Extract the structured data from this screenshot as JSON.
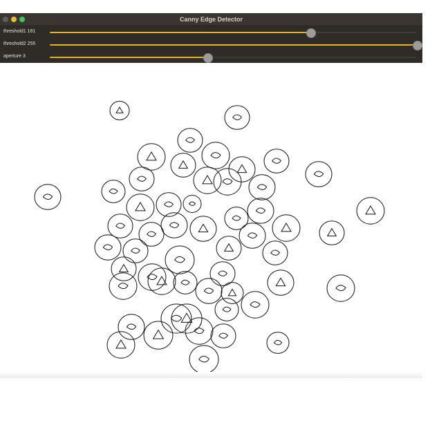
{
  "window": {
    "title": "Canny Edge Detector"
  },
  "controls": [
    {
      "label": "threshold1 181",
      "value": 181,
      "max": 255
    },
    {
      "label": "threshold2 255",
      "value": 255,
      "max": 255
    },
    {
      "label": "aperture 3",
      "value": 3,
      "max": 7
    }
  ],
  "image": {
    "description_icon": "edge-image"
  },
  "colors": {
    "titlebar": "#3a3530",
    "panel": "#2f2b27",
    "accent": "#e6b12c",
    "knob": "#9d9c9b"
  }
}
